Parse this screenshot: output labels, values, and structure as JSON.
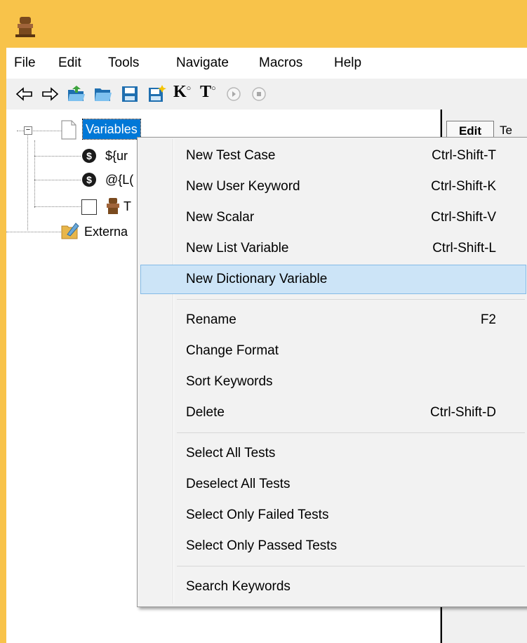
{
  "menubar": {
    "items": [
      {
        "label": "File"
      },
      {
        "label": "Edit"
      },
      {
        "label": "Tools"
      },
      {
        "label": "Navigate"
      },
      {
        "label": "Macros"
      },
      {
        "label": "Help"
      }
    ]
  },
  "toolbar": {
    "icons": [
      "back-arrow-icon",
      "forward-arrow-icon",
      "open-folder-icon",
      "open-directory-icon",
      "save-icon",
      "save-all-icon",
      "search-keywords-icon",
      "search-tests-icon",
      "run-icon",
      "stop-icon"
    ],
    "keyword_letter": "K",
    "test_letter": "T"
  },
  "tree": {
    "root_label": "Variables",
    "items": [
      {
        "label": "${ur"
      },
      {
        "label": "@{L("
      },
      {
        "label": "T"
      }
    ],
    "external_label": "Externa"
  },
  "right_panel": {
    "edit_tab": "Edit",
    "next_tab": "Te"
  },
  "context_menu": {
    "groups": [
      [
        {
          "label": "New Test Case",
          "shortcut": "Ctrl-Shift-T"
        },
        {
          "label": "New User Keyword",
          "shortcut": "Ctrl-Shift-K"
        },
        {
          "label": "New Scalar",
          "shortcut": "Ctrl-Shift-V"
        },
        {
          "label": "New List Variable",
          "shortcut": "Ctrl-Shift-L"
        },
        {
          "label": "New Dictionary Variable",
          "shortcut": ""
        }
      ],
      [
        {
          "label": "Rename",
          "shortcut": "F2"
        },
        {
          "label": "Change Format",
          "shortcut": ""
        },
        {
          "label": "Sort Keywords",
          "shortcut": ""
        },
        {
          "label": "Delete",
          "shortcut": "Ctrl-Shift-D"
        }
      ],
      [
        {
          "label": "Select All Tests",
          "shortcut": ""
        },
        {
          "label": "Deselect All Tests",
          "shortcut": ""
        },
        {
          "label": "Select Only Failed Tests",
          "shortcut": ""
        },
        {
          "label": "Select Only Passed Tests",
          "shortcut": ""
        }
      ],
      [
        {
          "label": "Search Keywords",
          "shortcut": ""
        }
      ]
    ],
    "highlighted": "New Dictionary Variable"
  },
  "colors": {
    "titlebar": "#f8c34a",
    "selection": "#0078d7",
    "menu_hover": "#cce4f7"
  }
}
